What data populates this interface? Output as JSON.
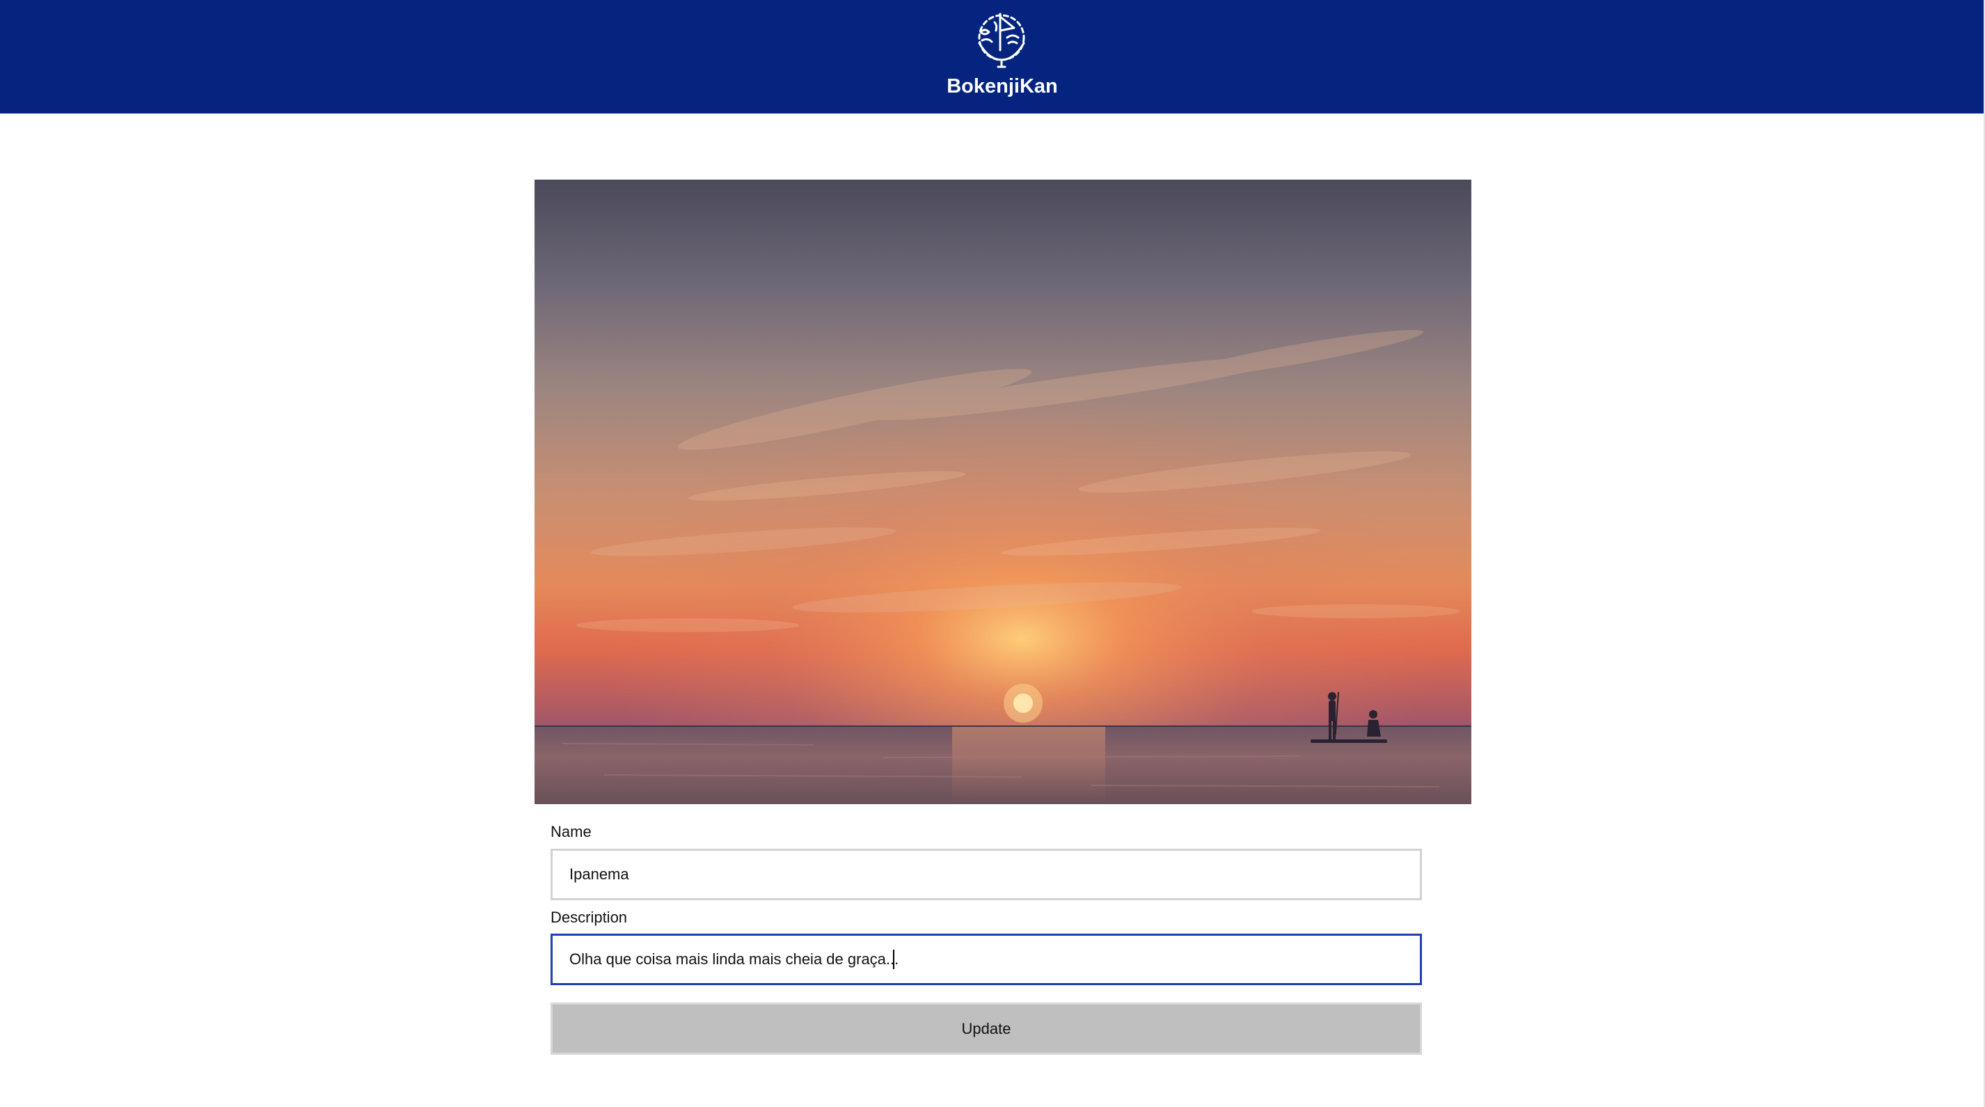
{
  "header": {
    "brand": "BokenjiKan",
    "logo_icon": "ship-wheel-anchor-icon",
    "background_color": "#04247f"
  },
  "photo": {
    "name": "sunset-sea-photo"
  },
  "form": {
    "name_label": "Name",
    "name_value": "Ipanema",
    "description_label": "Description",
    "description_value": "Olha que coisa mais linda mais cheia de graça...",
    "update_label": "Update"
  },
  "colors": {
    "focus_border": "#1f3fb3",
    "button_bg": "#bfbfbf"
  }
}
